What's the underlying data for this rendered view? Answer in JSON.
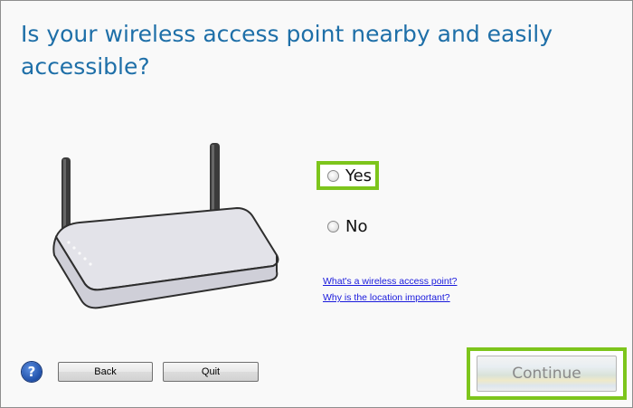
{
  "header": {
    "question": "Is your wireless access point nearby and easily accessible?"
  },
  "illustration": {
    "icon": "wireless-router-illustration"
  },
  "options": {
    "yes_label": "Yes",
    "no_label": "No",
    "highlight_color": "#7dc51c"
  },
  "links": {
    "what_is_ap": "What's a wireless access point?",
    "why_location": "Why is the location important?"
  },
  "footer": {
    "help_glyph": "?",
    "back_label": "Back",
    "quit_label": "Quit",
    "continue_label": "Continue"
  },
  "colors": {
    "title": "#1e6fa8",
    "link": "#1a1adc",
    "highlight": "#7dc51c"
  }
}
